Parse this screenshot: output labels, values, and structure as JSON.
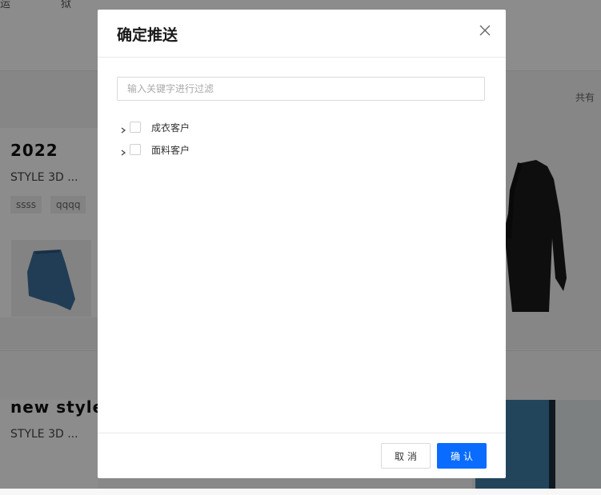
{
  "background": {
    "header_fragment_1": "运",
    "header_fragment_2": "狱",
    "total_prefix": "共有",
    "cards": [
      {
        "title": "2022",
        "subtitle": "STYLE 3D ...",
        "tags": [
          "ssss",
          "qqqq"
        ]
      },
      {
        "title": "new style",
        "subtitle": "STYLE 3D ..."
      }
    ]
  },
  "dialog": {
    "title": "确定推送",
    "close_icon": "close-icon",
    "filter_placeholder": "输入关键字进行过滤",
    "filter_value": "",
    "tree": [
      {
        "label": "成衣客户",
        "checked": false,
        "expanded": false
      },
      {
        "label": "面料客户",
        "checked": false,
        "expanded": false
      }
    ],
    "cancel_label": "取消",
    "confirm_label": "确认"
  },
  "colors": {
    "primary": "#0a6cff",
    "mask": "rgba(0,0,0,0.45)"
  }
}
